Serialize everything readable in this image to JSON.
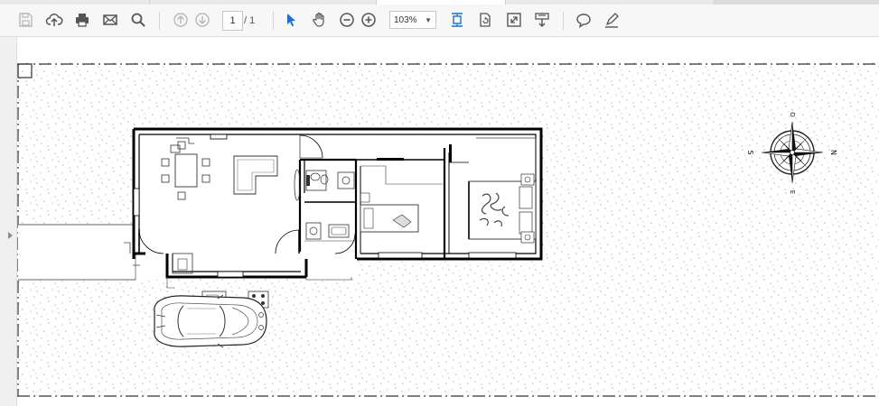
{
  "toolbar": {
    "page_current": "1",
    "page_total": "/ 1",
    "zoom": "103%"
  },
  "drawing": {
    "compass_n": "N",
    "compass_s": "S",
    "compass_e": "E",
    "compass_o": "O"
  }
}
